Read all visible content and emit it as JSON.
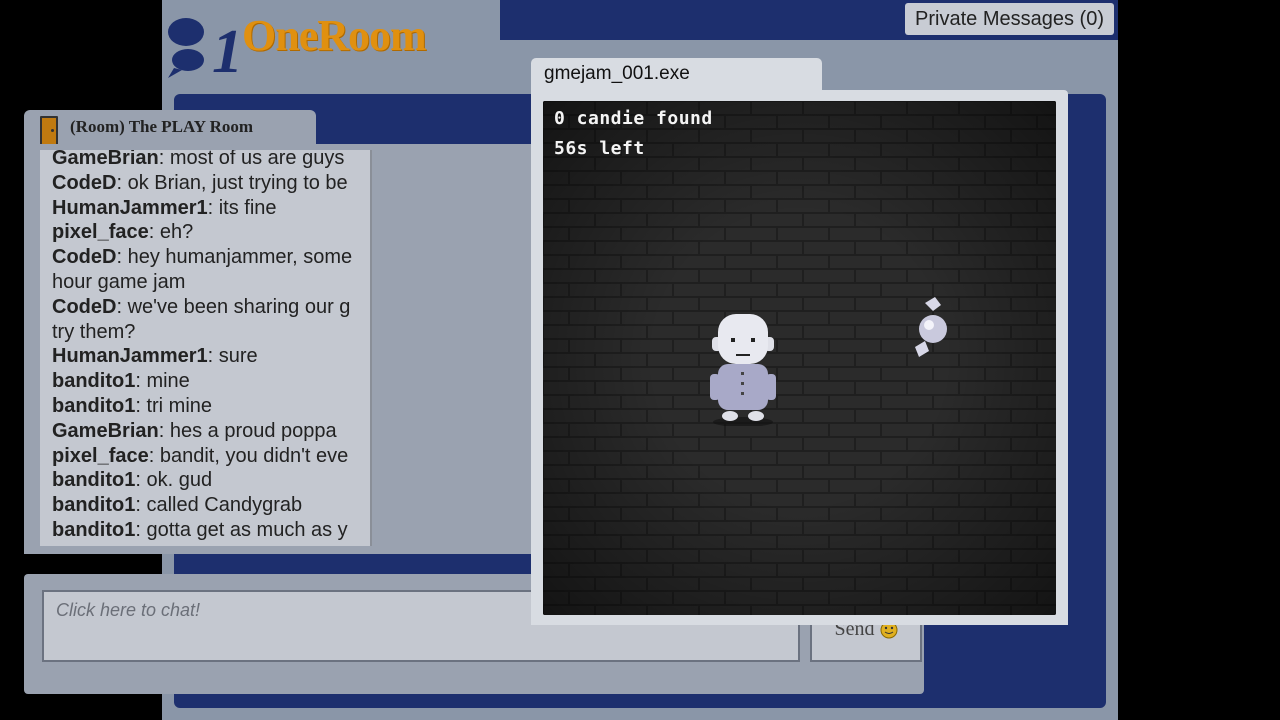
{
  "header": {
    "logo_text": "OneRoom",
    "private_messages_label": "Private Messages (0)"
  },
  "room": {
    "title": "(Room) The PLAY Room"
  },
  "chat": {
    "messages": [
      {
        "user": "GameBrian",
        "text": ": most of us are guys"
      },
      {
        "user": "CodeD",
        "text": ": ok Brian, just trying to be"
      },
      {
        "user": "HumanJammer1",
        "text": ": its fine"
      },
      {
        "user": "pixel_face",
        "text": ": eh?"
      },
      {
        "user": "CodeD",
        "text": ": hey humanjammer, some"
      },
      {
        "user": "",
        "text": "hour game jam"
      },
      {
        "user": "CodeD",
        "text": ": we've been sharing our g"
      },
      {
        "user": "",
        "text": "try them?"
      },
      {
        "user": "HumanJammer1",
        "text": ": sure"
      },
      {
        "user": "bandito1",
        "text": ": mine"
      },
      {
        "user": "bandito1",
        "text": ": tri mine"
      },
      {
        "user": "GameBrian",
        "text": ": hes a proud poppa"
      },
      {
        "user": "pixel_face",
        "text": ": bandit, you didn't eve"
      },
      {
        "user": "bandito1",
        "text": ": ok. gud"
      },
      {
        "user": "bandito1",
        "text": ": called Candygrab"
      },
      {
        "user": "bandito1",
        "text": ": gotta get as much as y"
      }
    ],
    "input_placeholder": "Click here to chat!",
    "send_label": "Send"
  },
  "game_window": {
    "title": "gmejam_001.exe",
    "hud_found": "0 candie found",
    "hud_time": "56s left"
  },
  "colors": {
    "header_blue": "#1d2f6e",
    "logo_orange": "#e09010",
    "panel_gray": "#9aa2b0"
  },
  "icons": [
    "chat-bubbles-logo-icon",
    "door-icon",
    "smiley-icon"
  ]
}
